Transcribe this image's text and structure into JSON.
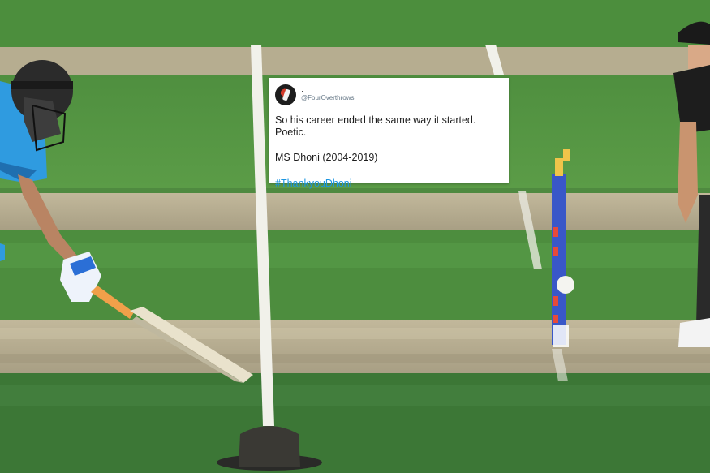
{
  "tweet": {
    "display_name": "·",
    "handle": "@FourOverthrows",
    "line1": "So his career ended the same way it started. Poetic.",
    "line2": "MS Dhoni (2004-2019)",
    "hashtag": "#ThankyouDhoni",
    "hashtag_color": "#1b95e0"
  },
  "colors": {
    "grass_light": "#5a9a45",
    "grass_dark": "#3c7536",
    "pitch": "#b9b094",
    "player_shirt_blue": "#2f9be0",
    "player_shirt_black": "#1c1c1c"
  }
}
